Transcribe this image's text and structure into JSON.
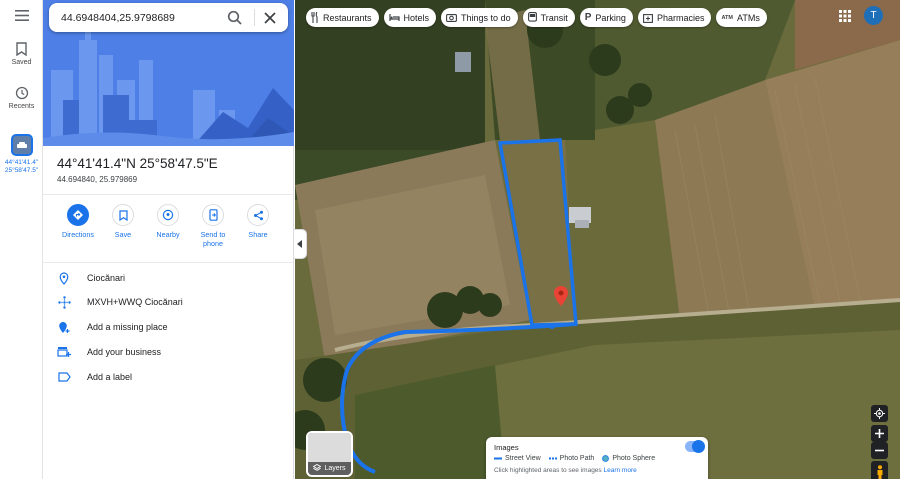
{
  "rail": {
    "saved_label": "Saved",
    "recents_label": "Recents",
    "selected_label_line1": "44°41'41.4\"",
    "selected_label_line2": "25°58'47.5\""
  },
  "search": {
    "value": "44.6948404,25.9798689"
  },
  "place": {
    "dms": "44°41'41.4\"N 25°58'47.5\"E",
    "decimal": "44.694840, 25.979869"
  },
  "actions": {
    "directions": "Directions",
    "save": "Save",
    "nearby": "Nearby",
    "send_line1": "Send to",
    "send_line2": "phone",
    "share": "Share"
  },
  "details": {
    "locality": "Ciocănari",
    "plus_code": "MXVH+WWQ Ciocănari",
    "add_missing": "Add a missing place",
    "add_business": "Add your business",
    "add_label": "Add a label"
  },
  "chips": [
    {
      "label": "Restaurants",
      "icon": "fork-knife-icon"
    },
    {
      "label": "Hotels",
      "icon": "bed-icon"
    },
    {
      "label": "Things to do",
      "icon": "camera-icon"
    },
    {
      "label": "Transit",
      "icon": "bus-icon"
    },
    {
      "label": "Parking",
      "icon": "parking-icon"
    },
    {
      "label": "Pharmacies",
      "icon": "pharmacy-icon"
    },
    {
      "label": "ATMs",
      "icon": "atm-icon",
      "prefix": "ATM"
    }
  ],
  "user": {
    "initial": "T"
  },
  "layers": {
    "label": "Layers"
  },
  "images": {
    "title": "Images",
    "street_view": "Street View",
    "photo_path": "Photo Path",
    "photo_sphere": "Photo Sphere",
    "hint_prefix": "Click highlighted areas to see images",
    "hint_link": "Learn more"
  },
  "colors": {
    "accent": "#1a73e8",
    "route": "#1a73e8",
    "pin": "#ea4335"
  }
}
